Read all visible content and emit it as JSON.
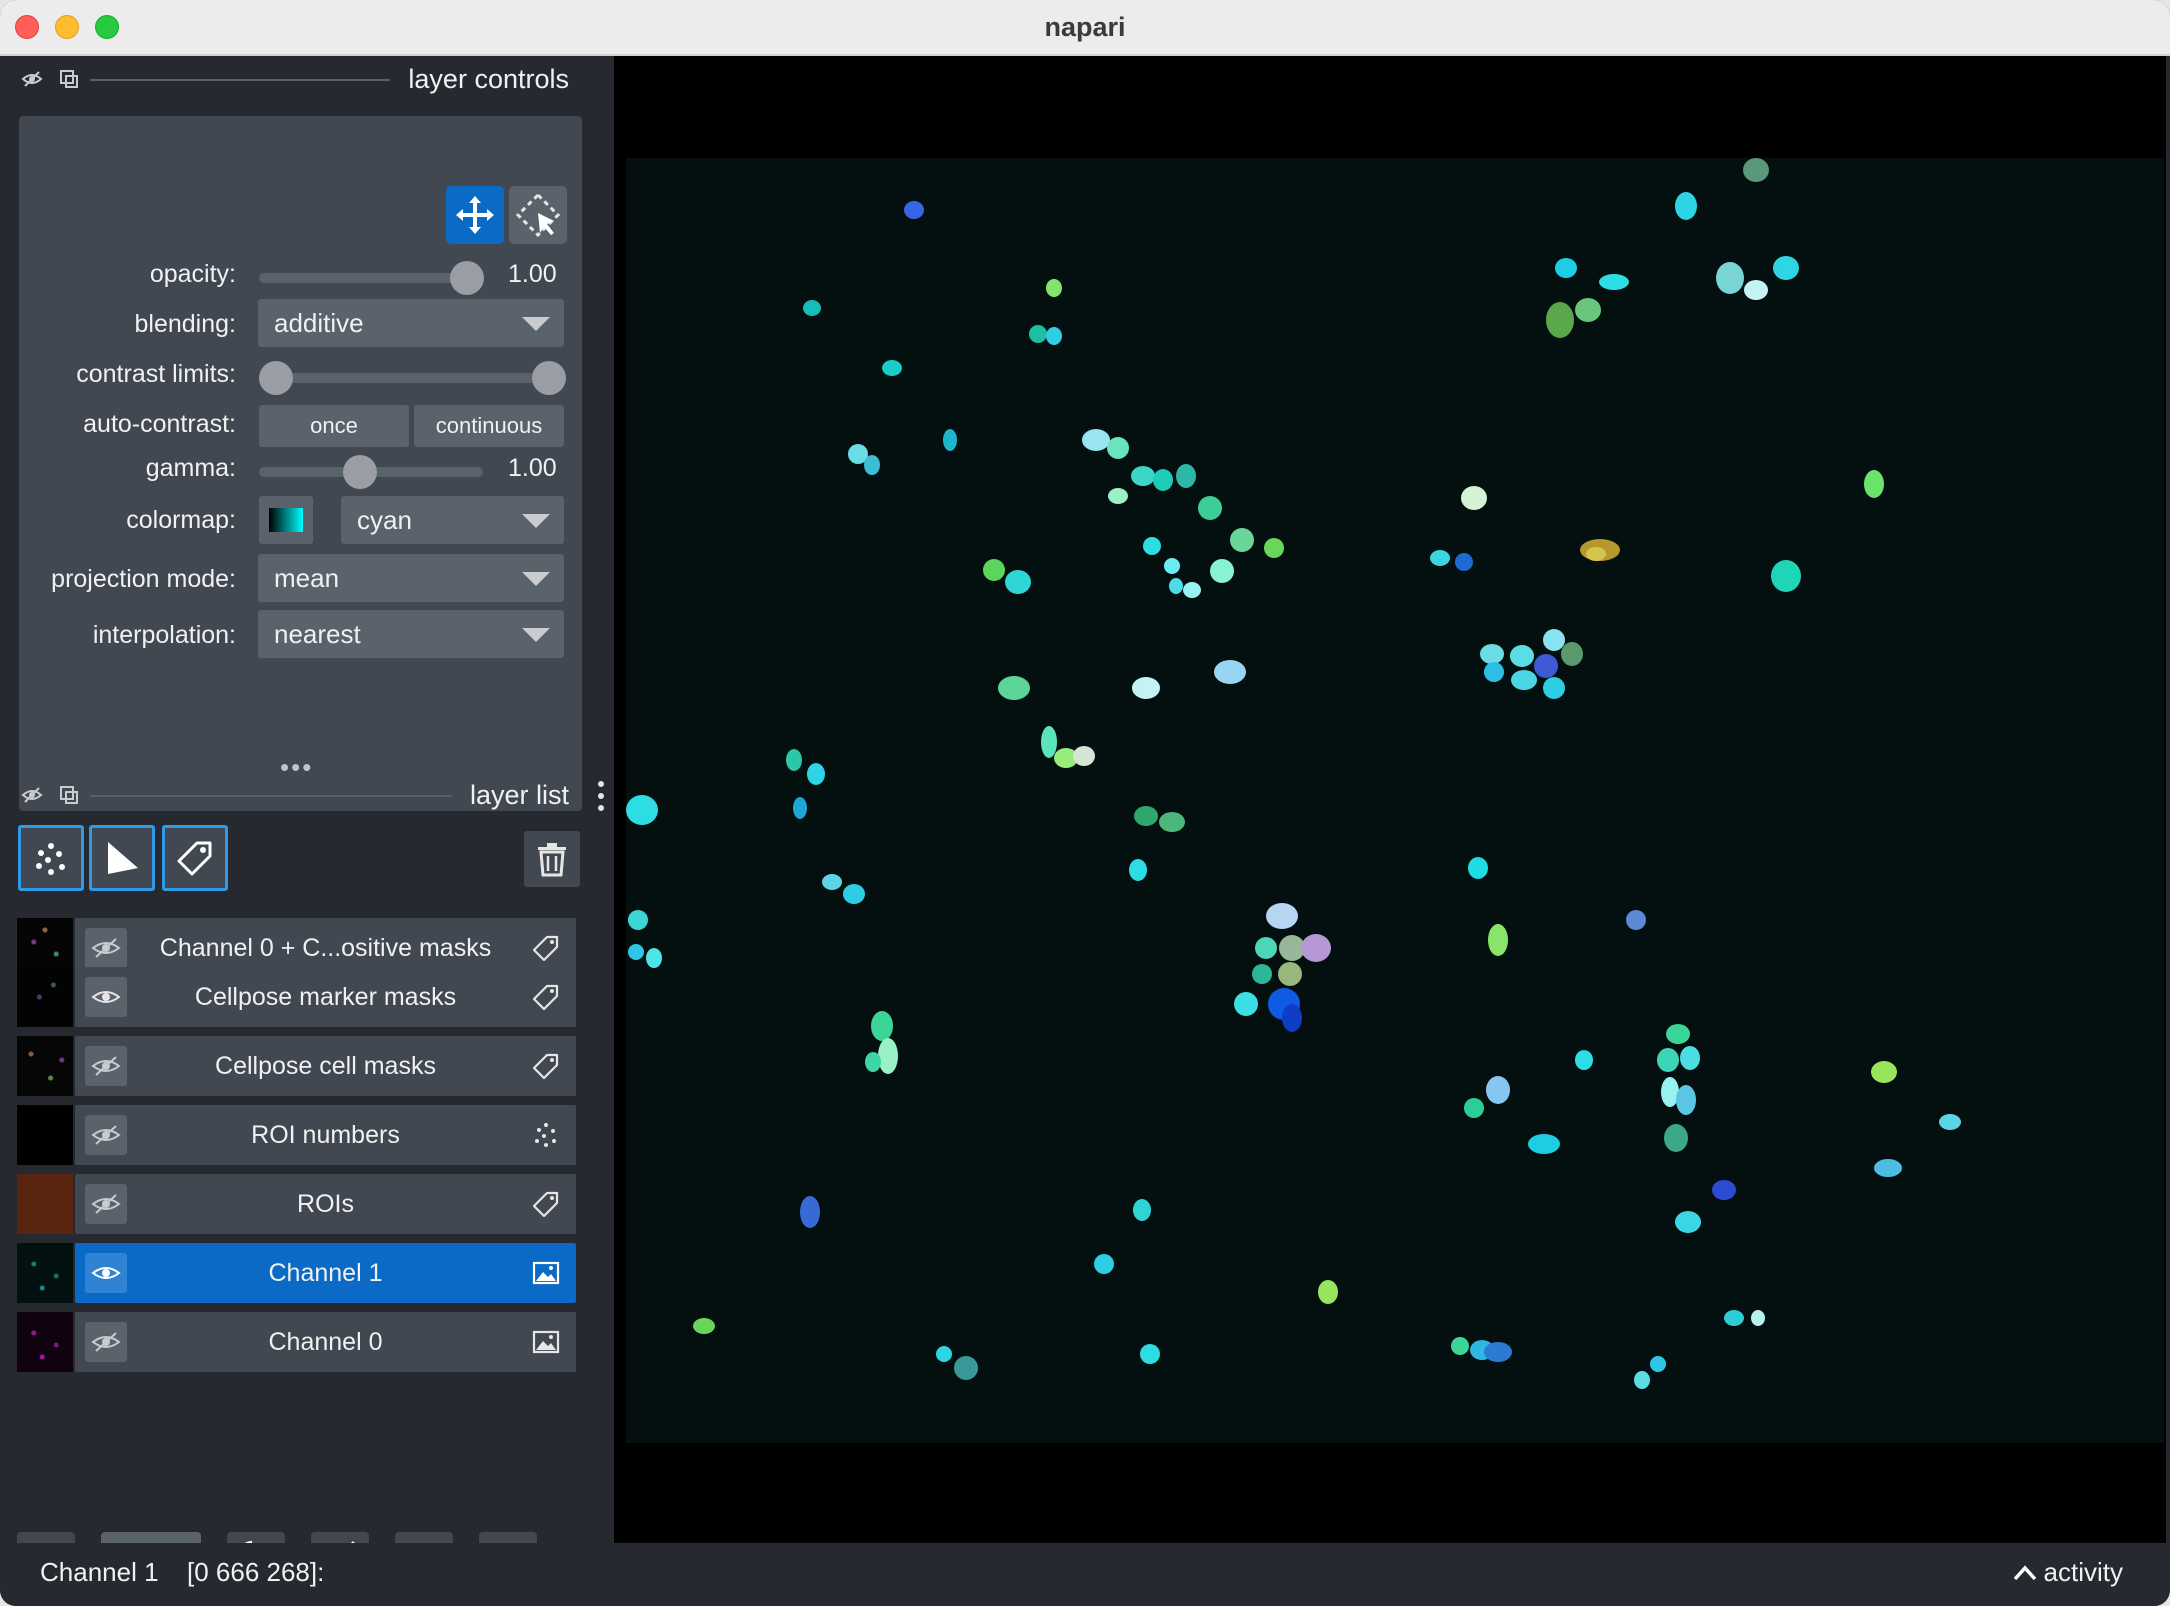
{
  "window": {
    "title": "napari"
  },
  "layer_controls": {
    "header_title": "layer controls",
    "opacity_label": "opacity:",
    "opacity_value": "1.00",
    "blending_label": "blending:",
    "blending_value": "additive",
    "contrast_label": "contrast limits:",
    "autocontrast_label": "auto-contrast:",
    "autocontrast_once": "once",
    "autocontrast_continuous": "continuous",
    "gamma_label": "gamma:",
    "gamma_value": "1.00",
    "colormap_label": "colormap:",
    "colormap_value": "cyan",
    "projection_label": "projection mode:",
    "projection_value": "mean",
    "interpolation_label": "interpolation:",
    "interpolation_value": "nearest"
  },
  "layer_list": {
    "header_title": "layer list",
    "layers": [
      {
        "name": "Channel 0 + C...ositive masks",
        "type_icon": "label-icon",
        "visible": false,
        "selected": false
      },
      {
        "name": "Cellpose marker masks",
        "type_icon": "label-icon",
        "visible": true,
        "selected": false
      },
      {
        "name": "Cellpose cell masks",
        "type_icon": "label-icon",
        "visible": false,
        "selected": false
      },
      {
        "name": "ROI numbers",
        "type_icon": "points-icon",
        "visible": false,
        "selected": false
      },
      {
        "name": "ROIs",
        "type_icon": "label-icon",
        "visible": false,
        "selected": false
      },
      {
        "name": "Channel 1",
        "type_icon": "image-icon",
        "visible": true,
        "selected": true
      },
      {
        "name": "Channel 0",
        "type_icon": "image-icon",
        "visible": false,
        "selected": false
      }
    ]
  },
  "status": {
    "layer": "Channel 1",
    "coords": "[0 666 268]:",
    "activity": "activity"
  },
  "colors": {
    "accent": "#0a6ac5",
    "panel": "#414851",
    "background": "#262930",
    "colormap_cyan": "#00ffff"
  }
}
